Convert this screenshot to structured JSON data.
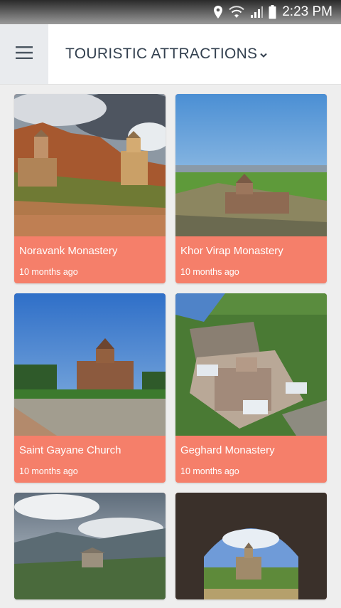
{
  "status_bar": {
    "time": "2:23 PM"
  },
  "header": {
    "title": "TOURISTIC ATTRACTIONS"
  },
  "cards": [
    {
      "name": "Noravank Monastery",
      "time": "10 months ago"
    },
    {
      "name": "Khor Virap Monastery",
      "time": "10 months ago"
    },
    {
      "name": "Saint Gayane Church",
      "time": "10 months ago"
    },
    {
      "name": "Geghard Monastery",
      "time": "10 months ago"
    }
  ],
  "colors": {
    "card_accent": "#f57f6a",
    "title_text": "#33404f"
  },
  "icons": [
    "location-icon",
    "wifi-icon",
    "signal-icon",
    "battery-icon",
    "menu-icon",
    "chevron-down-icon"
  ]
}
